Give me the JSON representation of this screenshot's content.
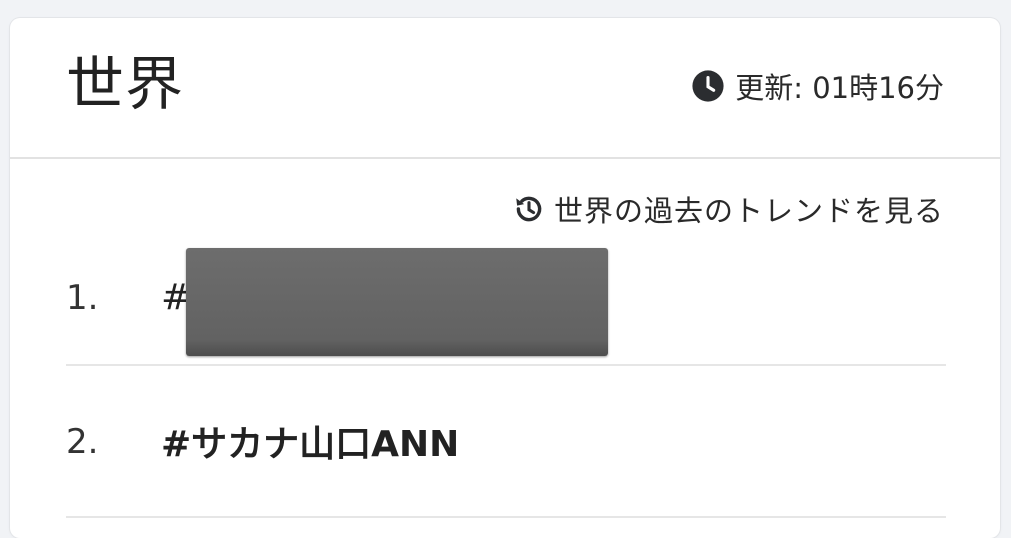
{
  "card": {
    "title": "世界",
    "updated_label": "更新: 01時16分",
    "past_trends_link": "世界の過去のトレンドを見る"
  },
  "icons": {
    "updated": "clock-icon",
    "past_trends": "history-icon"
  },
  "trends": [
    {
      "rank": "1.",
      "tag": "#",
      "redacted": true
    },
    {
      "rank": "2.",
      "tag": "#サカナ山口ANN",
      "redacted": false
    }
  ]
}
